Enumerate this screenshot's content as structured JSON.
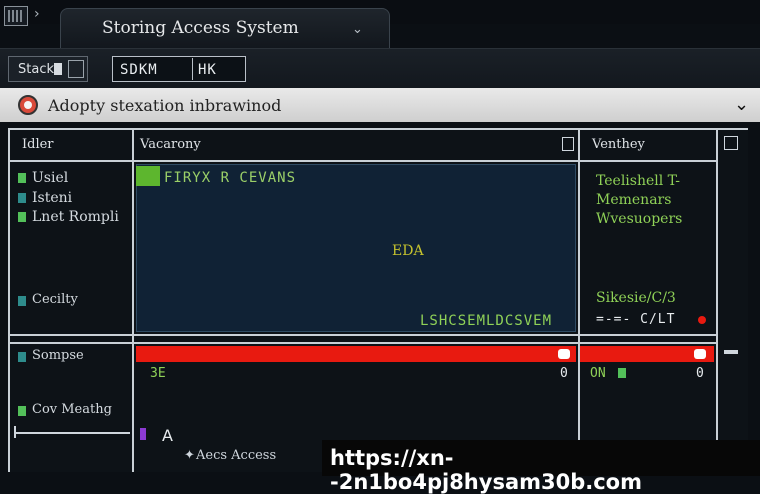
{
  "window": {
    "tab_title": "Storing Access System",
    "tab_caret": "⌄"
  },
  "toolbar": {
    "stack_label": "Stack",
    "field_left": "SDKM",
    "field_right": "HK"
  },
  "infobar": {
    "text": "Adopty stexation inbrawinod",
    "chevron": "⌄"
  },
  "columns": {
    "left_header": "Idler",
    "center_header": "Vacarony",
    "right_header": "Venthey"
  },
  "sidebar": {
    "items": [
      {
        "label": "Usiel"
      },
      {
        "label": "Isteni"
      },
      {
        "label": "Lnet Rompli"
      },
      {
        "label": "Cecilty"
      }
    ],
    "lower_items": [
      {
        "label": "Sompse"
      },
      {
        "label": "Cov Meathg"
      }
    ]
  },
  "center": {
    "header_text": "FIRYX R CEVANS",
    "mid_text": "EDA",
    "footer_text": "LSHCSEMLDCSVEM"
  },
  "right_panel": {
    "lines": [
      "Teelishell T-",
      "Memenars",
      "Wvesuopers"
    ],
    "status": "Sikesie/C/3",
    "status2": "=-=- C/LT"
  },
  "row2": {
    "left_val": "ЗЕ",
    "left_num": "0",
    "right_val": "ON",
    "right_num": "0"
  },
  "bottom": {
    "letter": "A",
    "access_text": "Aecs Access"
  },
  "watermark": {
    "text": "https://xn--2n1bo4pj8hysam30b.com"
  }
}
